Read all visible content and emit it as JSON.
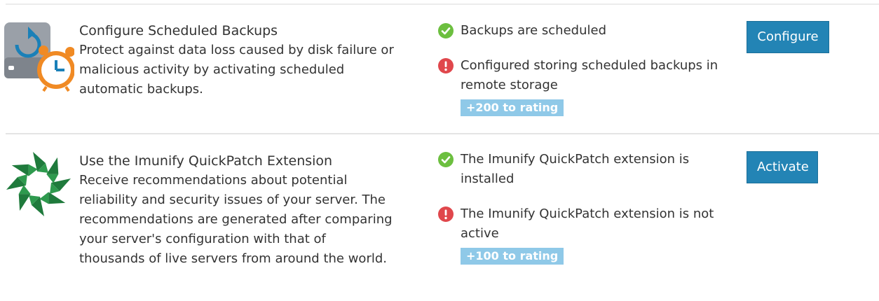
{
  "items": [
    {
      "icon": "backup-clock-icon",
      "title": "Configure Scheduled Backups",
      "description": "Protect against data loss caused by disk failure or malicious activity by activating scheduled automatic backups.",
      "checks": [
        {
          "status": "ok",
          "text": "Backups are scheduled"
        },
        {
          "status": "error",
          "text": "Configured storing scheduled backups in remote storage"
        }
      ],
      "rating": "+200 to rating",
      "button_label": "Configure"
    },
    {
      "icon": "imunify-star-icon",
      "title": "Use the Imunify QuickPatch Extension",
      "description": "Receive recommendations about potential reliability and security issues of your server. The recommendations are generated after comparing your server's configuration with that of thousands of live servers from around the world.",
      "checks": [
        {
          "status": "ok",
          "text": "The Imunify QuickPatch extension is installed"
        },
        {
          "status": "error",
          "text": "The Imunify QuickPatch extension is not active"
        }
      ],
      "rating": "+100 to rating",
      "button_label": "Activate"
    }
  ],
  "colors": {
    "ok": "#6cbf3f",
    "error": "#e0474c",
    "button": "#2384b5",
    "rating_badge": "#8fc9e8",
    "icon_green": "#1f7a3c",
    "clock_orange": "#f08a24"
  }
}
